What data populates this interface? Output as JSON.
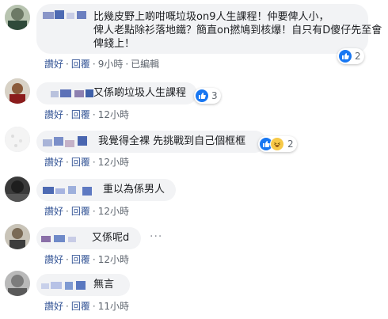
{
  "comments": [
    {
      "text": "比幾皮野上啲咁嘅垃圾on9人生課程！仲要俾人小，\n俾人老點除衫落地鐵？簡直on撚鳩到核爆！自只有D傻仔先至會\n俾錢上！",
      "reaction_count": "2",
      "actions": {
        "like": "讚好",
        "reply": "回覆",
        "time": "9小時",
        "edited": "已編輯"
      }
    },
    {
      "text": "又係啲垃圾人生課程",
      "reaction_count": "3",
      "actions": {
        "like": "讚好",
        "reply": "回覆",
        "time": "12小時"
      }
    },
    {
      "text": "我覺得全裸 先挑戰到自己個框框",
      "reaction_count": "2",
      "actions": {
        "like": "讚好",
        "reply": "回覆",
        "time": "12小時"
      }
    },
    {
      "text": "重以為係男人",
      "actions": {
        "like": "讚好",
        "reply": "回覆",
        "time": "12小時"
      }
    },
    {
      "text": "又係呢d",
      "more": "···",
      "actions": {
        "like": "讚好",
        "reply": "回覆",
        "time": "12小時"
      }
    },
    {
      "text": "無言",
      "actions": {
        "like": "讚好",
        "reply": "回覆",
        "time": "11小時"
      }
    }
  ],
  "separator": "·",
  "colors": {
    "bubble": "#f2f3f5",
    "link": "#385898",
    "meta": "#606770",
    "like": "#1877f2"
  },
  "icons": {
    "like": "thumbs-up-icon",
    "haha": "haha-face-icon"
  }
}
